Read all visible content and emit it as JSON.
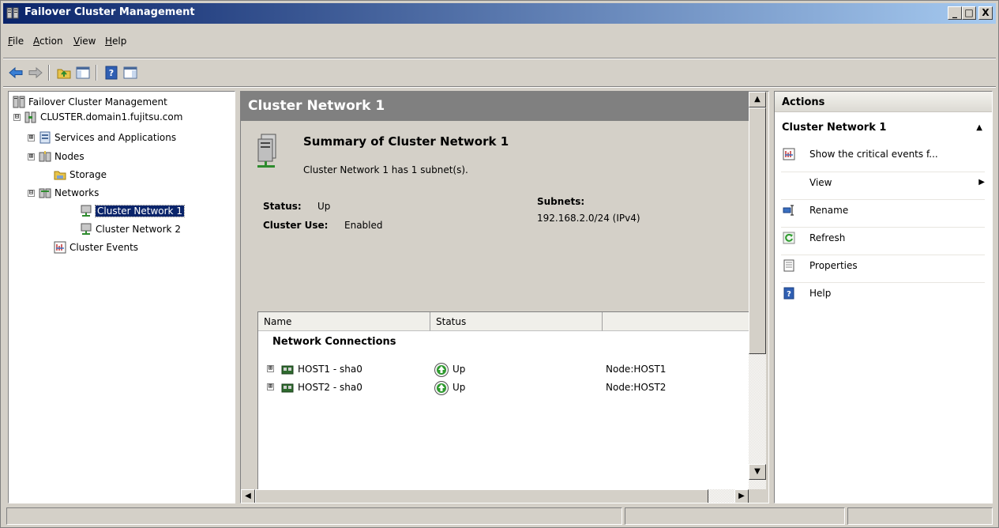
{
  "window": {
    "title": "Failover Cluster Management"
  },
  "window_controls": {
    "minimize": "_",
    "maximize": "□",
    "close": "X"
  },
  "menu": {
    "file": "File",
    "action": "Action",
    "view": "View",
    "help": "Help"
  },
  "tree": {
    "root": "Failover Cluster Management",
    "cluster": "CLUSTER.domain1.fujitsu.com",
    "services": "Services and Applications",
    "nodes": "Nodes",
    "storage": "Storage",
    "networks": "Networks",
    "network1": "Cluster Network 1",
    "network2": "Cluster Network 2",
    "events": "Cluster Events",
    "expanded": "⊟",
    "collapsed": "⊞"
  },
  "center": {
    "title": "Cluster Network 1",
    "summary_title": "Summary of Cluster Network 1",
    "summary_sub": "Cluster Network 1 has 1 subnet(s).",
    "status_label": "Status:",
    "status_value": "Up",
    "cluster_use_label": "Cluster Use:",
    "cluster_use_value": "Enabled",
    "subnets_label": "Subnets:",
    "subnets_value": "192.168.2.0/24 (IPv4)",
    "columns": [
      "Name",
      "Status",
      ""
    ],
    "group": "Network Connections",
    "rows": [
      {
        "name": "HOST1 - sha0",
        "status": "Up",
        "node": "Node:HOST1"
      },
      {
        "name": "HOST2 - sha0",
        "status": "Up",
        "node": "Node:HOST2"
      }
    ]
  },
  "actions": {
    "header": "Actions",
    "section": "Cluster Network 1",
    "items": [
      {
        "label": "Show the critical events f...",
        "icon": "events-icon"
      },
      {
        "label": "View",
        "icon": ""
      },
      {
        "label": "Rename",
        "icon": "rename-icon"
      },
      {
        "label": "Refresh",
        "icon": "refresh-icon"
      },
      {
        "label": "Properties",
        "icon": "properties-icon"
      },
      {
        "label": "Help",
        "icon": "help-icon"
      }
    ]
  },
  "colors": {
    "title_start": "#0a246a",
    "title_end": "#a6caf0",
    "selection": "#0a246a",
    "up_green": "#2e9a2e",
    "chrome": "#d4d0c8"
  }
}
